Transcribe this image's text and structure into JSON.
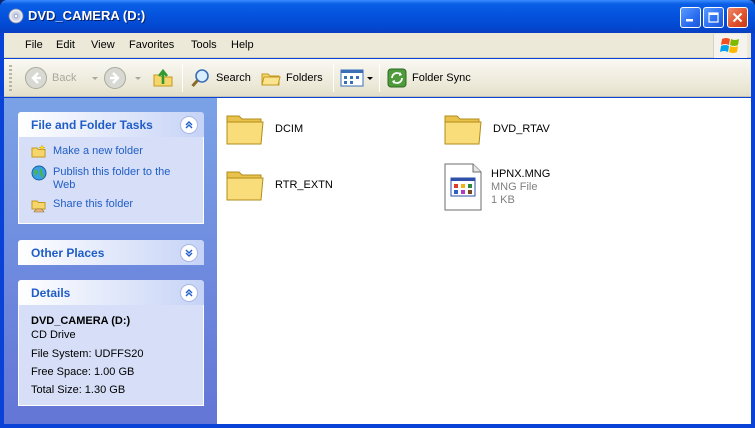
{
  "window": {
    "title": "DVD_CAMERA (D:)"
  },
  "menu": [
    "File",
    "Edit",
    "View",
    "Favorites",
    "Tools",
    "Help"
  ],
  "toolbar": {
    "back": "Back",
    "search": "Search",
    "folders": "Folders",
    "folder_sync": "Folder Sync"
  },
  "tasks_panel": {
    "title": "File and Folder Tasks",
    "items": [
      {
        "label": "Make a new folder",
        "icon": "new-folder-icon"
      },
      {
        "label": "Publish this folder to the Web",
        "icon": "globe-icon"
      },
      {
        "label": "Share this folder",
        "icon": "share-folder-icon"
      }
    ]
  },
  "other_places": {
    "title": "Other Places"
  },
  "details": {
    "title": "Details",
    "name": "DVD_CAMERA (D:)",
    "type": "CD Drive",
    "file_system": "File System: UDFFS20",
    "free_space": "Free Space: 1.00 GB",
    "total_size": "Total Size: 1.30 GB"
  },
  "files": [
    {
      "name": "DCIM",
      "kind": "folder"
    },
    {
      "name": "DVD_RTAV",
      "kind": "folder"
    },
    {
      "name": "RTR_EXTN",
      "kind": "folder"
    },
    {
      "name": "HPNX.MNG",
      "kind": "file",
      "type": "MNG File",
      "size": "1 KB"
    }
  ],
  "colors": {
    "titlebar": "#0453de",
    "pane_background": "#6f8fe0",
    "panel_header_text": "#215dc6",
    "panel_body": "#d6dff7",
    "menubar": "#ece9d8"
  }
}
